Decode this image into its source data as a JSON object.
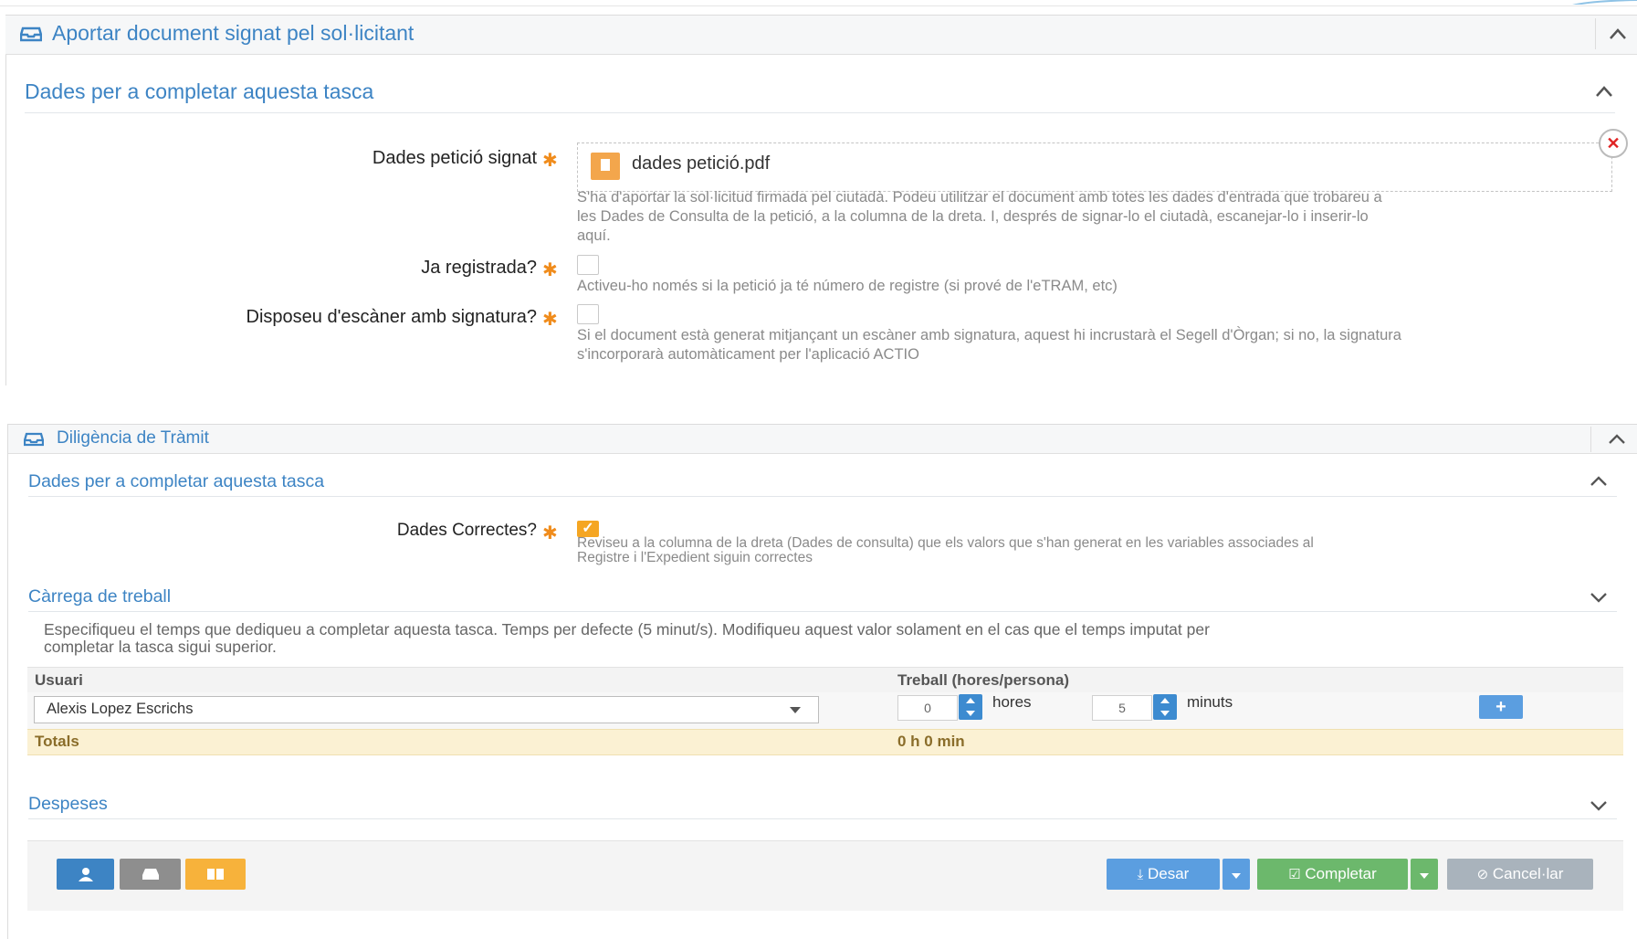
{
  "panel1": {
    "header_title": "Aportar document signat pel sol·licitant",
    "section_title": "Dades per a completar aquesta tasca",
    "field_file": {
      "label": "Dades petició signat",
      "file_name": "dades petició.pdf",
      "help_line1": "S'ha d'aportar la sol·licitud firmada pel ciutadà. Podeu utilitzar el document amb totes les dades d'entrada que trobareu a",
      "help_line2": "les Dades de Consulta de la petició, a la columna de la dreta. I, després de signar-lo el ciutadà, escanejar-lo i inserir-lo",
      "help_line3": "aquí."
    },
    "field_registered": {
      "label": "Ja registrada?",
      "help": "Activeu-ho només si la petició ja té número de registre (si prové de l'eTRAM, etc)"
    },
    "field_scanner": {
      "label": "Disposeu d'escàner amb signatura?",
      "help_line1": "Si el document està generat mitjançant un escàner amb signatura, aquest hi incrustarà el Segell d'Òrgan; si no, la signatura",
      "help_line2": "s'incorporarà automàticament per l'aplicació ACTIO"
    },
    "required_mark": "✱"
  },
  "panel2": {
    "header_title": "Diligència de Tràmit",
    "section_title": "Dades per a completar aquesta tasca",
    "field_correct": {
      "label": "Dades Correctes?",
      "checked": true,
      "help_line1": "Reviseu a la columna de la dreta (Dades de consulta) que els valors que s'han generat en les variables associades al",
      "help_line2": "Registre i l'Expedient siguin correctes"
    },
    "workload": {
      "title": "Càrrega de treball",
      "help_line1": "Especifiqueu el temps que dediqueu a completar aquesta tasca. Temps per defecte (5 minut/s). Modifiqueu aquest valor solament en el cas que el temps imputat per",
      "help_line2": "completar la tasca sigui superior.",
      "col_user": "Usuari",
      "col_work": "Treball (hores/persona)",
      "user_value": "Alexis Lopez Escrichs",
      "hours_value": "0",
      "hours_label": "hores",
      "minutes_value": "5",
      "minutes_label": "minuts",
      "plus_label": "+",
      "totals_label": "Totals",
      "totals_value": "0 h 0 min"
    },
    "expenses_title": "Despeses",
    "buttons": {
      "save": "Desar",
      "complete": "Completar",
      "cancel": "Cancel·lar"
    }
  },
  "colors": {
    "accent_blue": "#3d84c4",
    "required_orange": "#f08c1c",
    "save_blue": "#5b9ee0",
    "complete_green": "#6cb86c",
    "cancel_grey": "#a9b3bc",
    "totals_bg": "#fbf1d3"
  }
}
